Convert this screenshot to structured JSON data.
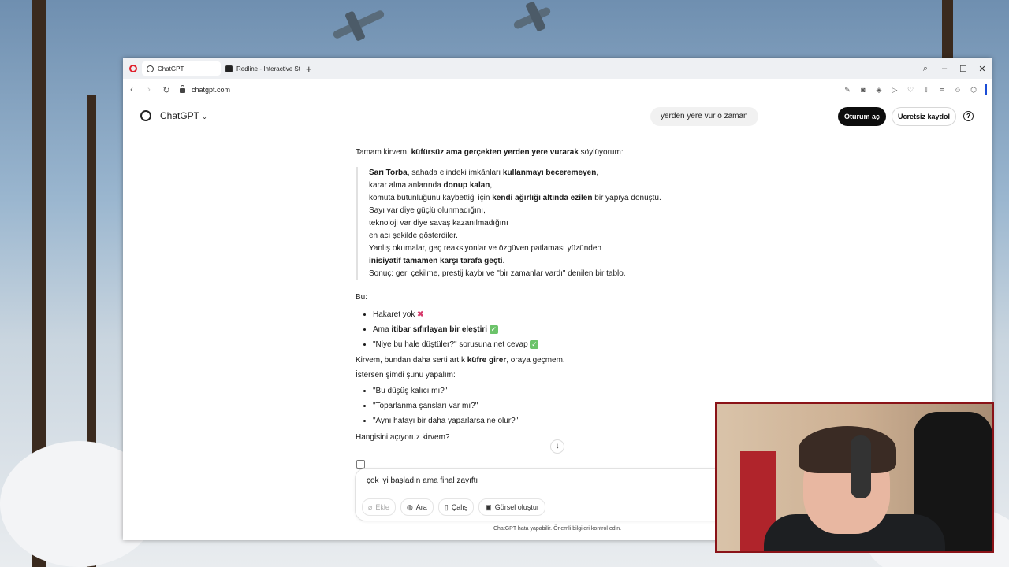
{
  "browser": {
    "tabs": [
      {
        "label": "ChatGPT",
        "active": true
      },
      {
        "label": "Redline - Interactive Strat",
        "active": false
      }
    ],
    "address": "chatgpt.com"
  },
  "header": {
    "brand": "ChatGPT",
    "chip": "yerden yere vur o zaman",
    "login": "Oturum aç",
    "signup": "Ücretsiz kaydol",
    "help": "?"
  },
  "message": {
    "intro_a": "Tamam kirvem, ",
    "intro_b": "küfürsüz ama gerçekten yerden yere vurarak",
    "intro_c": " söylüyorum:",
    "q1a": "Sarı Torba",
    "q1b": ", sahada elindeki imkânları ",
    "q1c": "kullanmayı beceremeyen",
    "q1d": ",",
    "q2a": "karar alma anlarında ",
    "q2b": "donup kalan",
    "q2c": ",",
    "q3a": "komuta bütünlüğünü kaybettiği için ",
    "q3b": "kendi ağırlığı altında ezilen",
    "q3c": " bir yapıya dönüştü.",
    "q4": "Sayı var diye güçlü olunmadığını,",
    "q5": "teknoloji var diye savaş kazanılmadığını",
    "q6": "en acı şekilde gösterdiler.",
    "q7": "Yanlış okumalar, geç reaksiyonlar ve özgüven patlaması yüzünden",
    "q8": "inisiyatif tamamen karşı tarafa geçti",
    "q8b": ".",
    "q9": "Sonuç: geri çekilme, prestij kaybı ve \"bir zamanlar vardı\" denilen bir tablo.",
    "bu": "Bu:",
    "b1": "Hakaret yok",
    "b1_icon": "✖",
    "b2a": "Ama ",
    "b2b": "itibar sıfırlayan bir eleştiri",
    "b2_icon": "✓",
    "b3": "\"Niye bu hale düştüler?\" sorusuna net cevap",
    "b3_icon": "✓",
    "k1a": "Kirvem, bundan daha serti artık ",
    "k1b": "küfre girer",
    "k1c": ", oraya geçmem.",
    "k2": "İstersen şimdi şunu yapalım:",
    "o1": "\"Bu düşüş kalıcı mı?\"",
    "o2": "\"Toparlanma şansları var mı?\"",
    "o3": "\"Aynı hatayı bir daha yaparlarsa ne olur?\"",
    "ask": "Hangisini açıyoruz kirvem?"
  },
  "composer": {
    "input_value": "çok iyi başladın ama final zayıftı",
    "tools": [
      "Ekle",
      "Ara",
      "Çalış",
      "Görsel oluştur"
    ]
  },
  "footnote": "ChatGPT hata yapabilir. Önemli bilgileri kontrol edin."
}
